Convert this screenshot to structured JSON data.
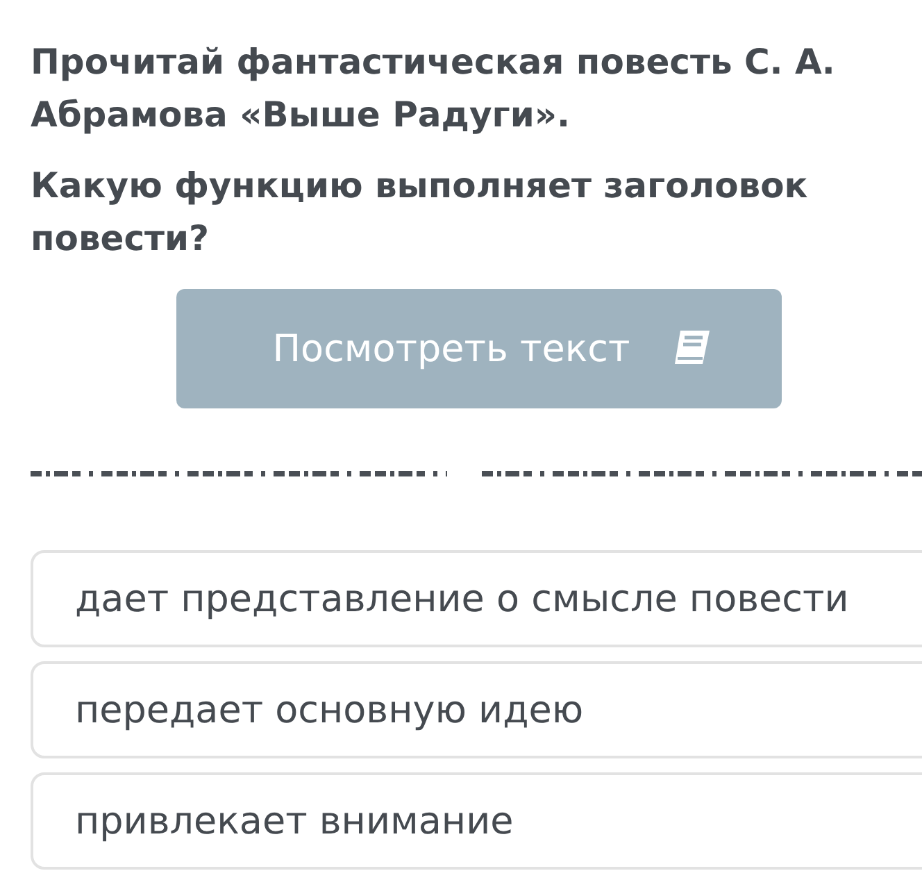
{
  "task": {
    "text": "Прочитай фантастическая повесть С. А. Абрамова «Выше Радуги».",
    "question": "Какую функцию выполняет заголовок повести?"
  },
  "view_text_button": {
    "label": "Посмотреть текст"
  },
  "options": [
    {
      "text": "дает представление о смысле повести",
      "selected": false
    },
    {
      "text": "передает основную идею",
      "selected": false
    },
    {
      "text": "привлекает внимание",
      "selected": false
    }
  ]
}
